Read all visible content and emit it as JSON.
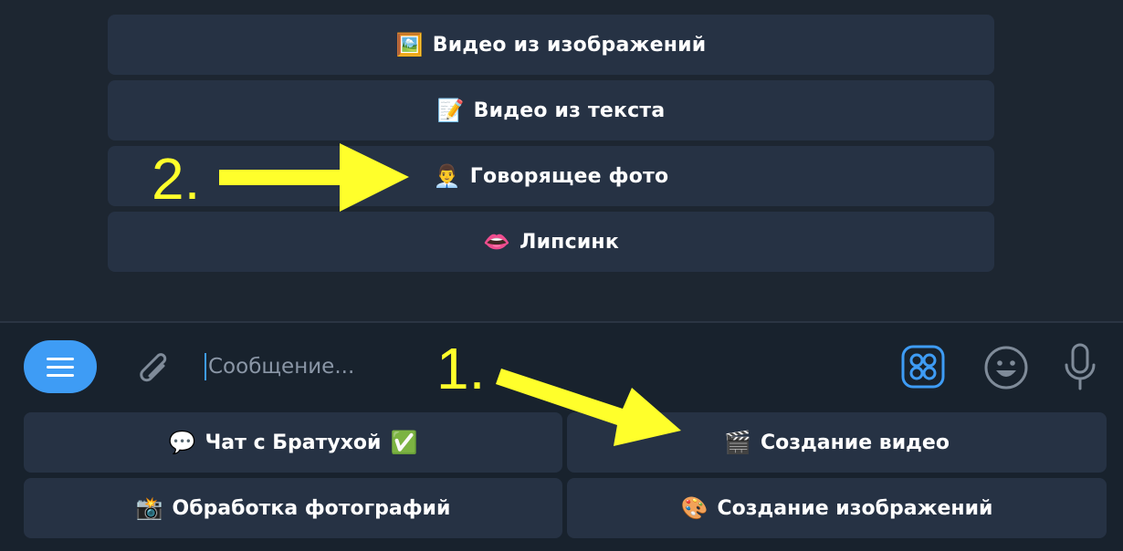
{
  "inline_keyboard": [
    {
      "emoji": "🖼️",
      "label": "Видео из изображений"
    },
    {
      "emoji": "📝",
      "label": "Видео из текста"
    },
    {
      "emoji": "👨‍💼",
      "label": "Говорящее фото"
    },
    {
      "emoji": "👄",
      "label": "Липсинк"
    }
  ],
  "composer": {
    "placeholder": "Сообщение..."
  },
  "reply_keyboard": [
    {
      "emoji": "💬",
      "label": "Чат с Братухой",
      "suffix": "✅"
    },
    {
      "emoji": "🎬",
      "label": "Создание видео",
      "suffix": ""
    },
    {
      "emoji": "📸",
      "label": "Обработка фотографий",
      "suffix": ""
    },
    {
      "emoji": "🎨",
      "label": "Создание изображений",
      "suffix": ""
    }
  ],
  "annotations": {
    "step_1": "1.",
    "step_2": "2.",
    "arrow_color": "#ffff2b"
  },
  "icons": [
    "menu-icon",
    "attach-icon",
    "sticker-keyboard-icon",
    "emoji-icon",
    "microphone-icon",
    "arrow-icon"
  ],
  "colors": {
    "accent": "#3e9cf5",
    "button_bg": "#263244",
    "background": "#18222d"
  }
}
